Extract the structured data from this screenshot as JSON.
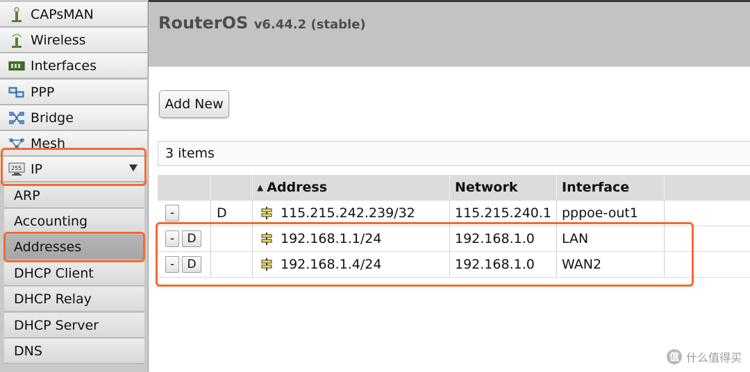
{
  "sidebar": {
    "items": [
      {
        "label": "CAPsMAN",
        "icon": "capsman-antenna-icon"
      },
      {
        "label": "Wireless",
        "icon": "wireless-antenna-icon"
      },
      {
        "label": "Interfaces",
        "icon": "interfaces-card-icon"
      },
      {
        "label": "PPP",
        "icon": "ppp-network-icon"
      },
      {
        "label": "Bridge",
        "icon": "bridge-network-icon"
      },
      {
        "label": "Mesh",
        "icon": "mesh-network-icon"
      },
      {
        "label": "IP",
        "icon": "ip-monitor-icon",
        "expanded": true
      }
    ],
    "ip_submenu": [
      {
        "label": "ARP"
      },
      {
        "label": "Accounting"
      },
      {
        "label": "Addresses",
        "active": true
      },
      {
        "label": "DHCP Client"
      },
      {
        "label": "DHCP Relay"
      },
      {
        "label": "DHCP Server"
      },
      {
        "label": "DNS"
      }
    ]
  },
  "header": {
    "product": "RouterOS",
    "version": "v6.44.2 (stable)"
  },
  "toolbar": {
    "add_new_label": "Add New"
  },
  "list": {
    "count_text": "3 items",
    "columns": [
      "",
      "",
      "Address",
      "Network",
      "Interface"
    ],
    "sort_indicator": "▲",
    "rows": [
      {
        "remove": "-",
        "disable": "",
        "flag": "D",
        "address": "115.215.242.239/32",
        "network": "115.215.240.1",
        "interface": "pppoe-out1"
      },
      {
        "remove": "-",
        "disable": "D",
        "flag": "",
        "address": "192.168.1.1/24",
        "network": "192.168.1.0",
        "interface": "LAN"
      },
      {
        "remove": "-",
        "disable": "D",
        "flag": "",
        "address": "192.168.1.4/24",
        "network": "192.168.1.0",
        "interface": "WAN2"
      }
    ]
  },
  "watermark": {
    "mark": "值",
    "text": "什么值得买"
  },
  "colors": {
    "highlight": "#f26b2d",
    "header_bg": "#c3c3c3",
    "sidebar_bg": "#c9c9c9"
  }
}
